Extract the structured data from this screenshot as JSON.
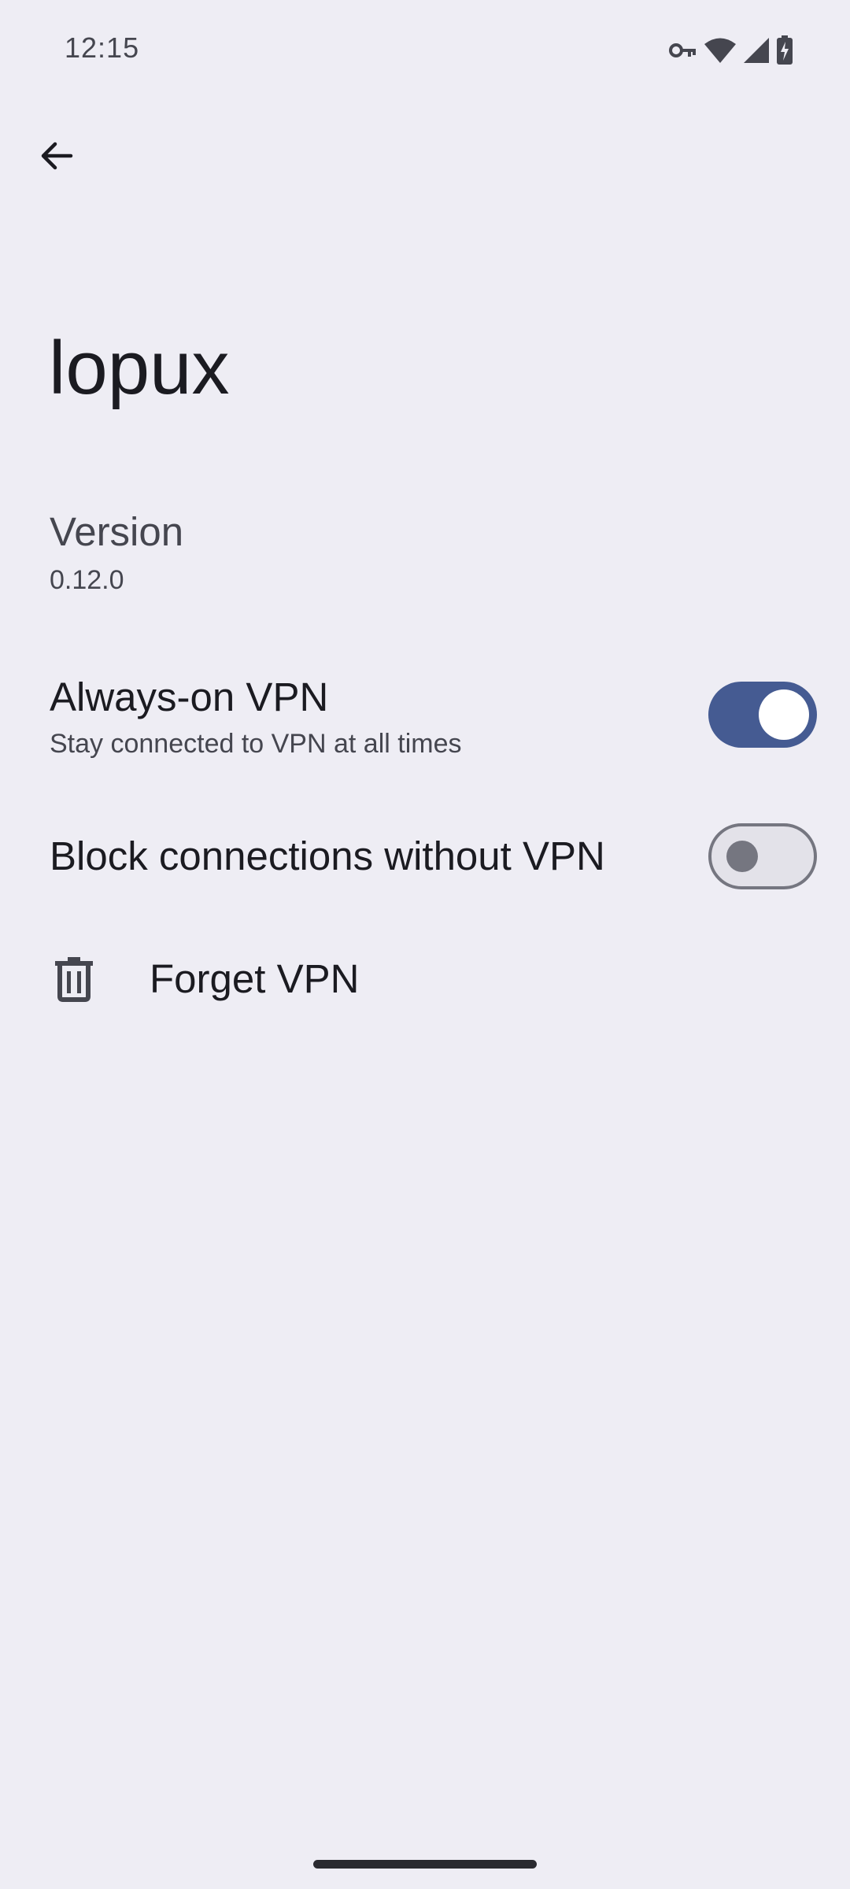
{
  "status_bar": {
    "time": "12:15",
    "icons": [
      "vpn-key-icon",
      "wifi-icon",
      "cell-signal-icon",
      "battery-charging-icon"
    ]
  },
  "header": {
    "back_icon": "arrow-back-icon",
    "title": "lopux"
  },
  "preferences": {
    "version": {
      "title": "Version",
      "summary": "0.12.0"
    },
    "always_on": {
      "title": "Always-on VPN",
      "summary": "Stay connected to VPN at all times",
      "checked": true
    },
    "block_connections": {
      "title": "Block connections without VPN",
      "checked": false
    },
    "forget": {
      "label": "Forget VPN",
      "icon": "trash-icon"
    }
  },
  "colors": {
    "background": "#eeedf4",
    "switch_on": "#455b92",
    "switch_off_track": "#e3e2e9",
    "switch_off_outline": "#757680"
  }
}
